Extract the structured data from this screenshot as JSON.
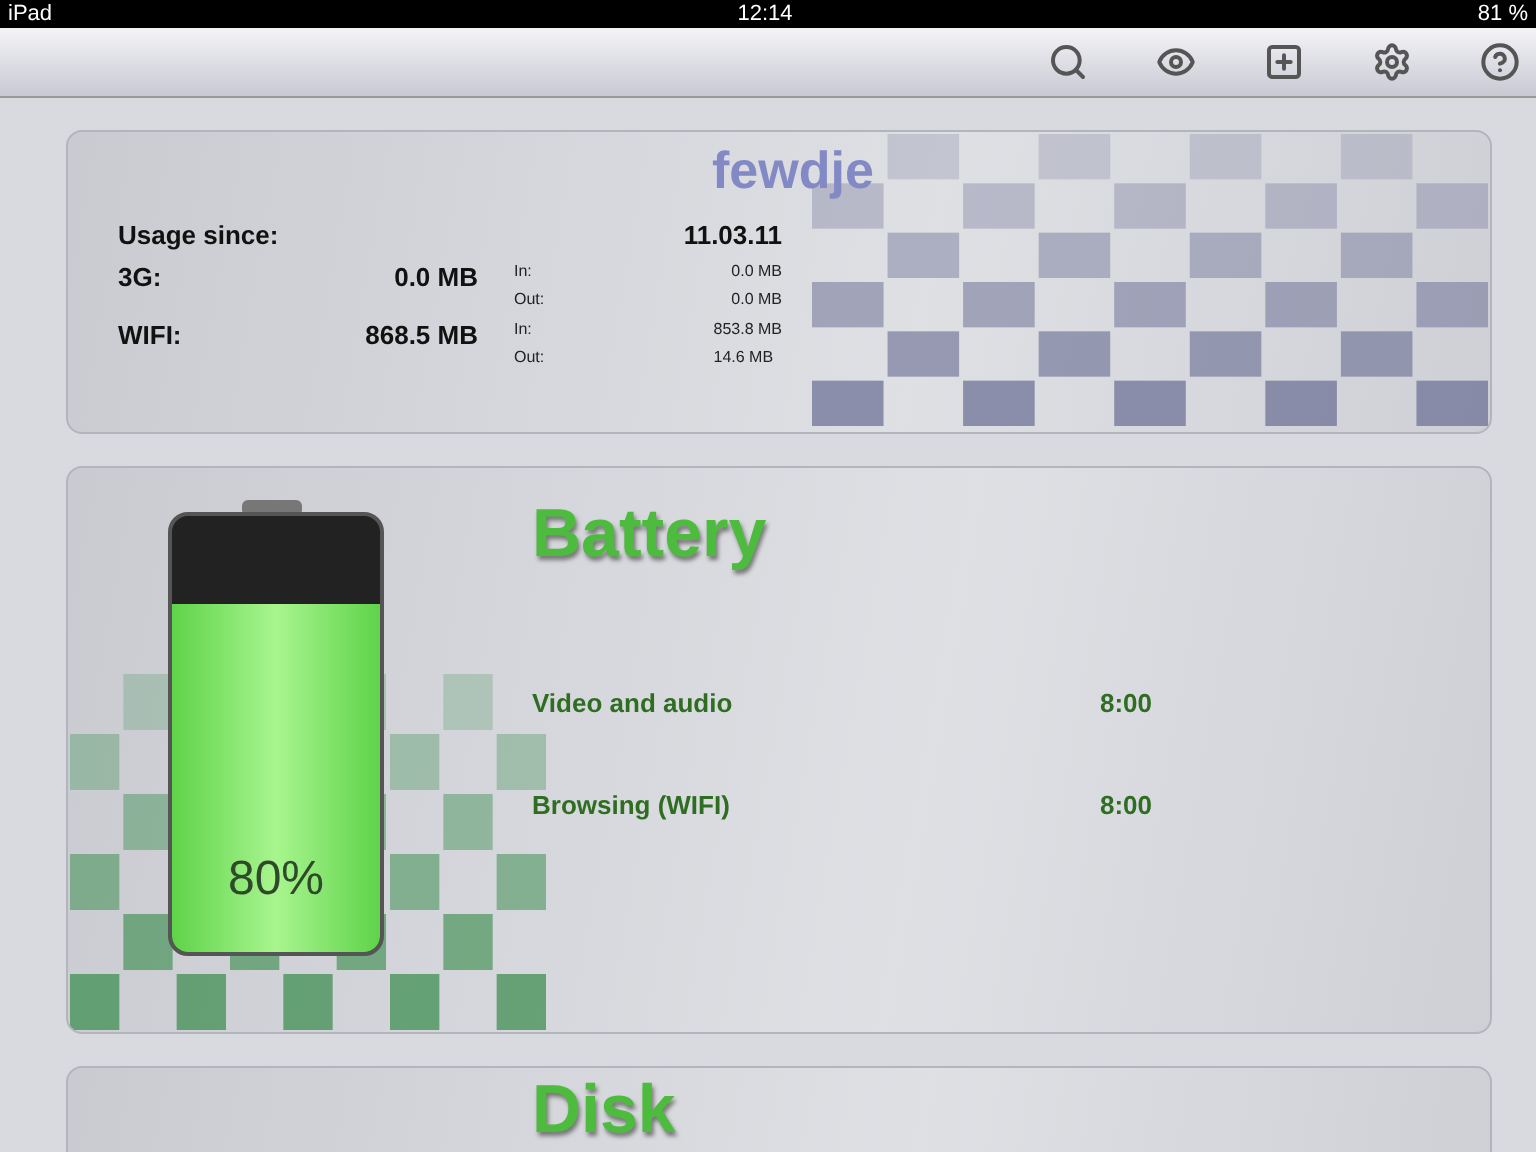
{
  "status_bar": {
    "device": "iPad",
    "time": "12:14",
    "battery": "81 %"
  },
  "usage": {
    "title": "fewdje",
    "since_label": "Usage since:",
    "since_value": "11.03.11",
    "rows": [
      {
        "label": "3G:",
        "total": "0.0 MB",
        "details": [
          {
            "label": "In:",
            "value": "0.0 MB"
          },
          {
            "label": "Out:",
            "value": "0.0 MB"
          }
        ]
      },
      {
        "label": "WIFI:",
        "total": "868.5 MB",
        "details": [
          {
            "label": "In:",
            "value": "853.8 MB"
          },
          {
            "label": "Out:",
            "value": "14.6 MB"
          }
        ]
      }
    ]
  },
  "battery": {
    "title": "Battery",
    "level": 0.8,
    "percent": "80%",
    "rows": [
      {
        "label": "Video and audio",
        "value": "8:00"
      },
      {
        "label": "Browsing (WIFI)",
        "value": "8:00"
      }
    ]
  },
  "disk": {
    "title": "Disk"
  }
}
